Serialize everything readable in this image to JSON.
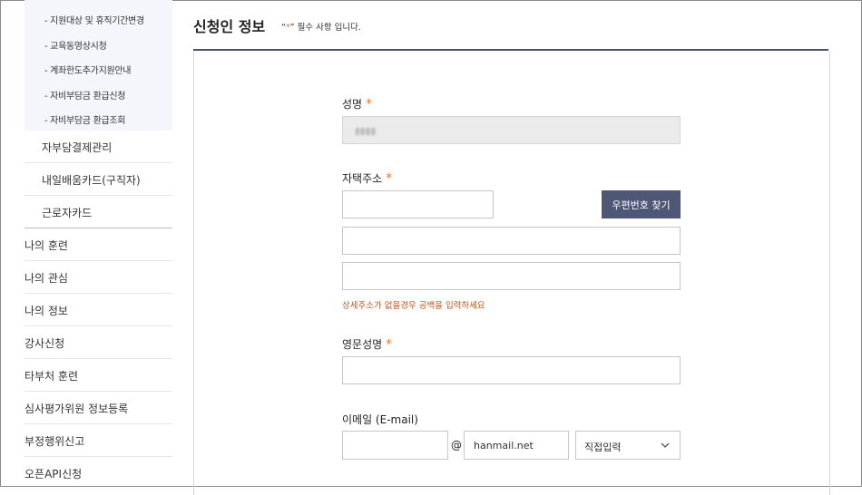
{
  "sidebar": {
    "sub_items": [
      "- 지원대상 및 휴직기간변경",
      "- 교육동영상시청",
      "- 계좌한도추가지원안내",
      "- 자비부담금 환급신청",
      "- 자비부담금 환급조회"
    ],
    "level2_items": [
      "자부담결제관리",
      "내일배움카드(구직자)",
      "근로자카드"
    ],
    "level1_items": [
      "나의 훈련",
      "나의 관심",
      "나의 정보",
      "강사신청",
      "타부처 훈련",
      "심사평가위원 정보등록",
      "부정행위신고",
      "오픈API신청"
    ]
  },
  "header": {
    "title": "신청인 정보",
    "req_quote_open": "“",
    "req_star": "*",
    "req_quote_close": "”",
    "req_text": " 필수 사항 입니다."
  },
  "form": {
    "name_label": "성명",
    "address_label": "자택주소",
    "zip_button": "우편번호 찾기",
    "address_hint": "상세주소가 없을경우 공백을 입력하세요",
    "english_name_label": "영문성명",
    "email_label": "이메일 (E-mail)",
    "email_at": "@",
    "email_domain": "hanmail.net",
    "email_select": "직접입력",
    "required_star": "*"
  },
  "colors": {
    "accent": "#4e5775",
    "required": "#e07b2c",
    "hint": "#c0561c"
  }
}
